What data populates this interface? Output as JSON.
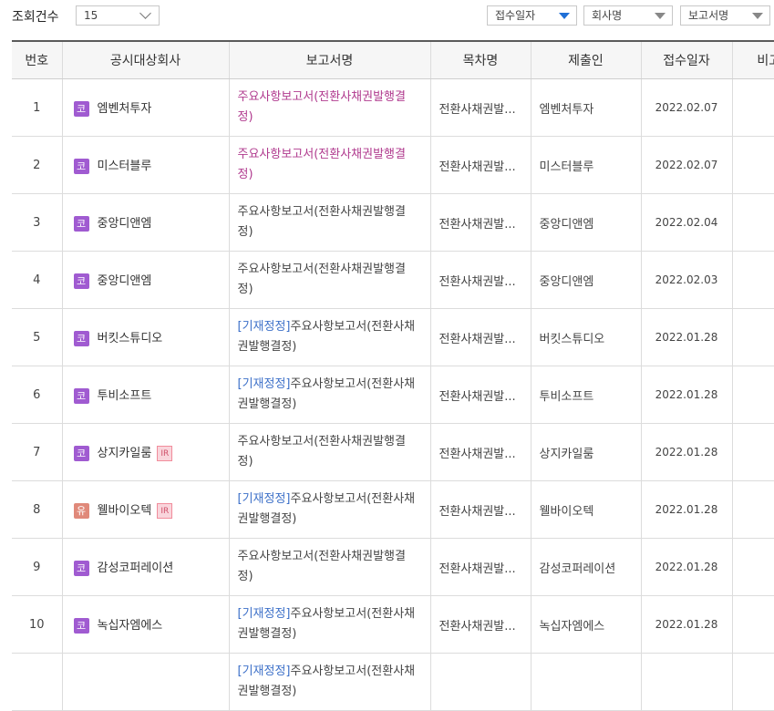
{
  "filters": {
    "count_label": "조회건수",
    "count_value": "15",
    "sort1": "접수일자",
    "sort2": "회사명",
    "sort3": "보고서명"
  },
  "table": {
    "headers": [
      "번호",
      "공시대상회사",
      "보고서명",
      "목차명",
      "제출인",
      "접수일자",
      "비고"
    ],
    "rows": [
      {
        "no": "1",
        "badge": "코",
        "company": "엠벤처투자",
        "ir": "",
        "prefix": "",
        "report": "주요사항보고서(전환사채권발행결정)",
        "toc": "전환사채권발...",
        "submitter": "엠벤처투자",
        "date": "2022.02.07",
        "visited": true
      },
      {
        "no": "2",
        "badge": "코",
        "company": "미스터블루",
        "ir": "",
        "prefix": "",
        "report": "주요사항보고서(전환사채권발행결정)",
        "toc": "전환사채권발...",
        "submitter": "미스터블루",
        "date": "2022.02.07",
        "visited": true
      },
      {
        "no": "3",
        "badge": "코",
        "company": "중앙디앤엠",
        "ir": "",
        "prefix": "",
        "report": "주요사항보고서(전환사채권발행결정)",
        "toc": "전환사채권발...",
        "submitter": "중앙디앤엠",
        "date": "2022.02.04",
        "visited": false
      },
      {
        "no": "4",
        "badge": "코",
        "company": "중앙디앤엠",
        "ir": "",
        "prefix": "",
        "report": "주요사항보고서(전환사채권발행결정)",
        "toc": "전환사채권발...",
        "submitter": "중앙디앤엠",
        "date": "2022.02.03",
        "visited": false
      },
      {
        "no": "5",
        "badge": "코",
        "company": "버킷스튜디오",
        "ir": "",
        "prefix": "[기재정정]",
        "report": "주요사항보고서(전환사채권발행결정)",
        "toc": "전환사채권발...",
        "submitter": "버킷스튜디오",
        "date": "2022.01.28",
        "visited": false
      },
      {
        "no": "6",
        "badge": "코",
        "company": "투비소프트",
        "ir": "",
        "prefix": "[기재정정]",
        "report": "주요사항보고서(전환사채권발행결정)",
        "toc": "전환사채권발...",
        "submitter": "투비소프트",
        "date": "2022.01.28",
        "visited": false
      },
      {
        "no": "7",
        "badge": "코",
        "company": "상지카일룸",
        "ir": "IR",
        "prefix": "",
        "report": "주요사항보고서(전환사채권발행결정)",
        "toc": "전환사채권발...",
        "submitter": "상지카일룸",
        "date": "2022.01.28",
        "visited": false
      },
      {
        "no": "8",
        "badge": "유",
        "company": "웰바이오텍",
        "ir": "IR",
        "prefix": "[기재정정]",
        "report": "주요사항보고서(전환사채권발행결정)",
        "toc": "전환사채권발...",
        "submitter": "웰바이오텍",
        "date": "2022.01.28",
        "visited": false
      },
      {
        "no": "9",
        "badge": "코",
        "company": "감성코퍼레이션",
        "ir": "",
        "prefix": "",
        "report": "주요사항보고서(전환사채권발행결정)",
        "toc": "전환사채권발...",
        "submitter": "감성코퍼레이션",
        "date": "2022.01.28",
        "visited": false
      },
      {
        "no": "10",
        "badge": "코",
        "company": "녹십자엠에스",
        "ir": "",
        "prefix": "[기재정정]",
        "report": "주요사항보고서(전환사채권발행결정)",
        "toc": "전환사채권발...",
        "submitter": "녹십자엠에스",
        "date": "2022.01.28",
        "visited": false
      },
      {
        "no": "",
        "badge": "",
        "company": "",
        "ir": "",
        "prefix": "[기재정정]",
        "report": "주요사항보고서(전환사채권발행결정)",
        "toc": "",
        "submitter": "",
        "date": "",
        "visited": false
      }
    ]
  }
}
